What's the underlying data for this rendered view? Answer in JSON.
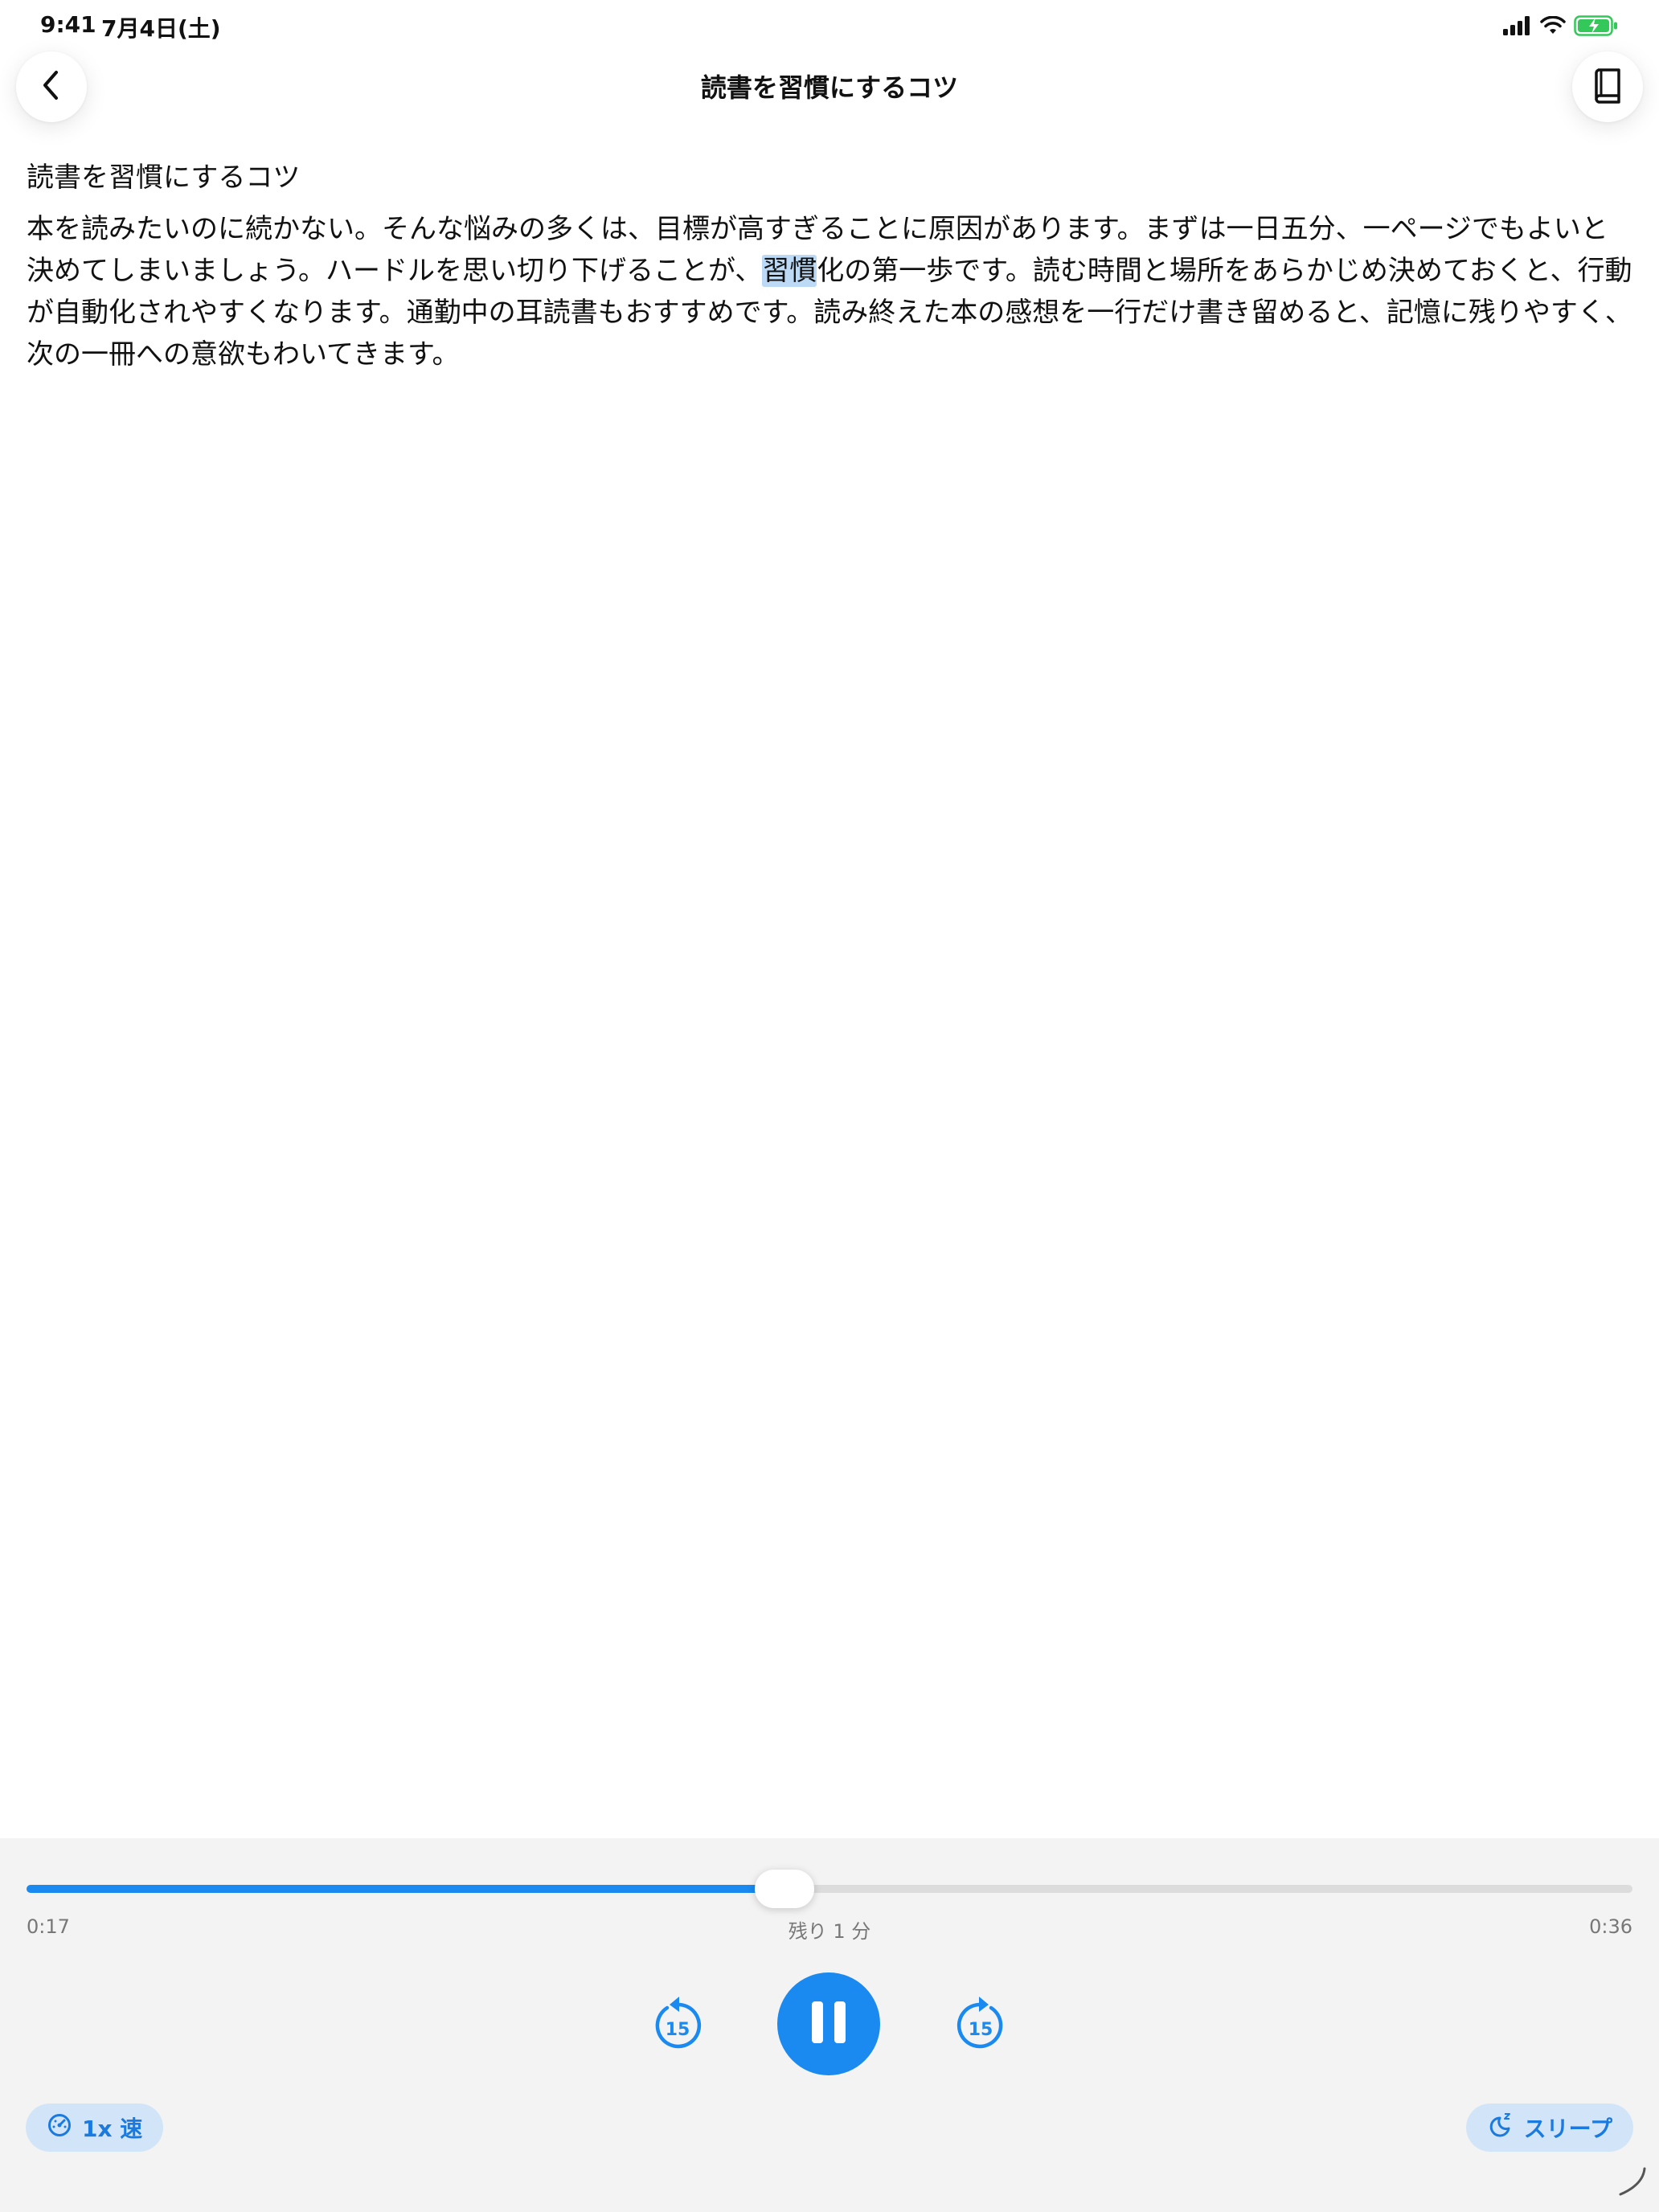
{
  "status_bar": {
    "time": "9:41",
    "date": "7月4日(土)",
    "icons": [
      "cellular-signal-icon",
      "wifi-icon",
      "battery-charging-icon"
    ]
  },
  "nav": {
    "title": "読書を習慣にするコツ",
    "back_icon": "chevron-left-icon",
    "right_icon": "book-icon"
  },
  "article": {
    "heading": "読書を習慣にするコツ",
    "body_before": "本を読みたいのに続かない。そんな悩みの多くは、目標が高すぎることに原因があります。まずは一日五分、一ページでもよいと決めてしまいましょう。ハードルを思い切り下げることが、",
    "body_highlight": "習慣",
    "body_after": "化の第一歩です。読む時間と場所をあらかじめ決めておくと、行動が自動化されやすくなります。通勤中の耳読書もおすすめです。読み終えた本の感想を一行だけ書き留めると、記憶に残りやすく、次の一冊への意欲もわいてきます。"
  },
  "player": {
    "progress_fraction": 0.472,
    "elapsed": "0:17",
    "remaining": "残り 1 分",
    "total": "0:36",
    "skip_back_label": "15",
    "skip_forward_label": "15",
    "state": "playing",
    "speed_label": "1x 速",
    "sleep_label": "スリープ"
  },
  "colors": {
    "accent": "#1a8af0",
    "pill_bg": "#d2e5f8",
    "highlight": "#bcd9f5",
    "panel_bg": "#f3f3f3",
    "battery_green": "#34c759"
  }
}
